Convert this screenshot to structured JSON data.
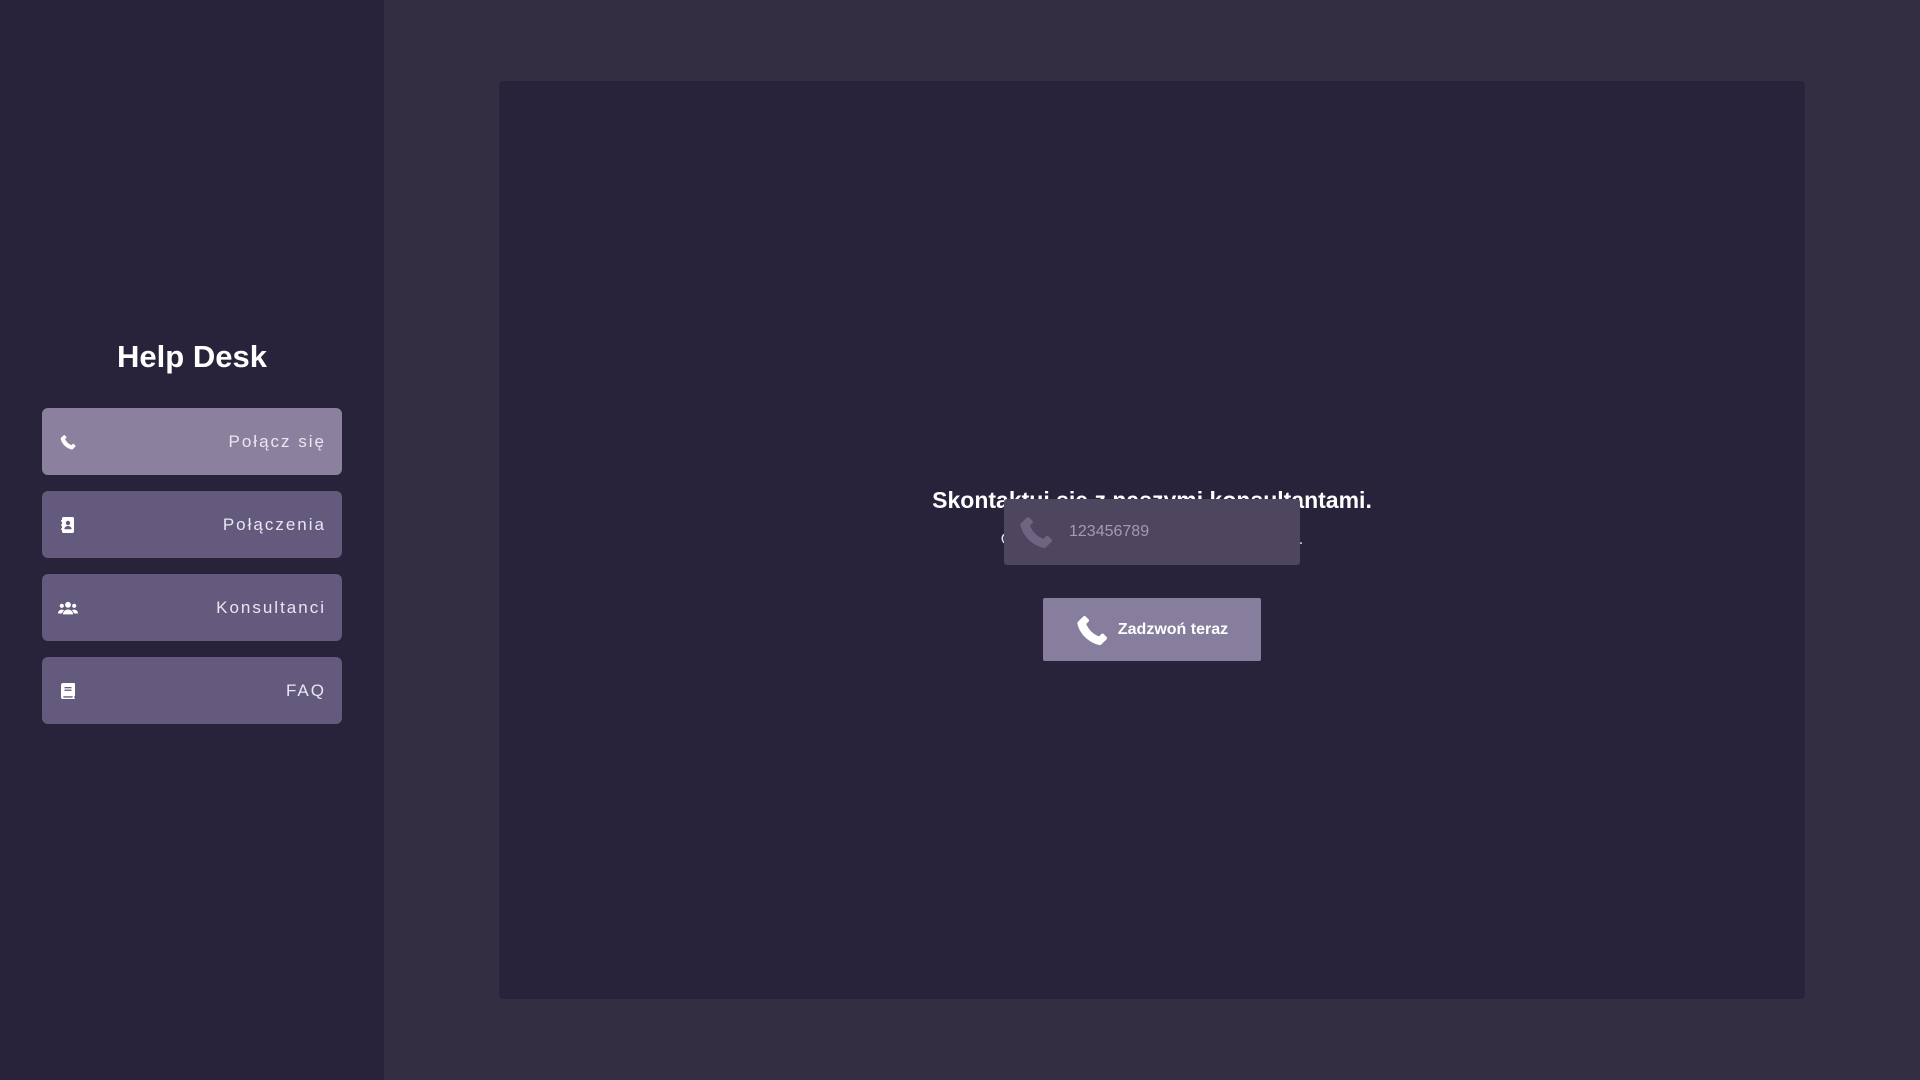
{
  "sidebar": {
    "title": "Help Desk",
    "items": [
      {
        "label": "Połącz się",
        "icon": "phone-icon",
        "active": true
      },
      {
        "label": "Połączenia",
        "icon": "address-book-icon",
        "active": false
      },
      {
        "label": "Konsultanci",
        "icon": "users-icon",
        "active": false
      },
      {
        "label": "FAQ",
        "icon": "book-icon",
        "active": false
      }
    ]
  },
  "main": {
    "heading": "Skontaktuj się z naszymi konsultantami.",
    "subheading": "Oddzwonimy do ciebie w ciągu 26 sekund.",
    "phone_input": {
      "value": "",
      "placeholder": "123456789",
      "icon": "phone-icon"
    },
    "call_button": {
      "label": "Zadzwoń teraz",
      "icon": "phone-icon"
    }
  },
  "colors": {
    "page_background": "#342e43",
    "sidebar_background": "#28233a",
    "panel_background": "#28233a",
    "nav_item": "#645a7d",
    "nav_item_active": "#8b819f",
    "input_background": "#4e465f",
    "button_background": "#877d9c",
    "text_primary": "#ffffff"
  }
}
